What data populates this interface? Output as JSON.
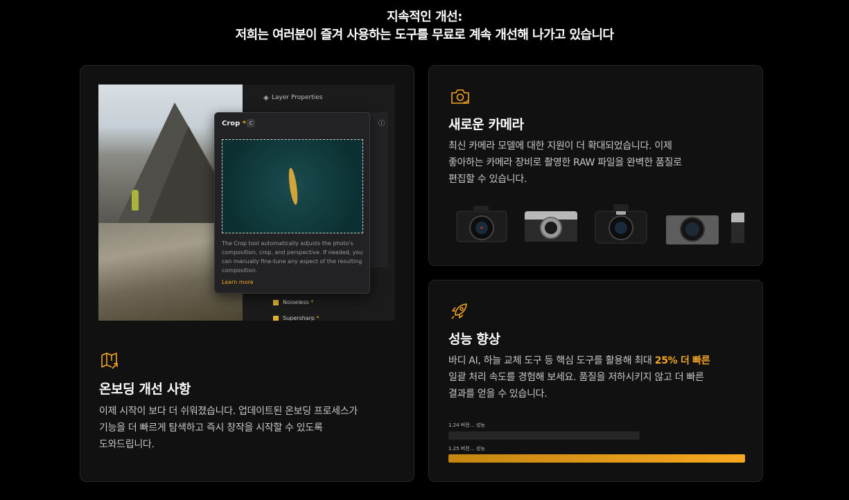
{
  "header": {
    "line1": "지속적인 개선:",
    "line2": "저희는 여러분이 즐겨 사용하는 도구를 무료로 계속 개선해 나가고 있습니다"
  },
  "onboarding": {
    "icon": "map-icon",
    "title": "온보딩 개선 사항",
    "body_line1": "이제 시작이 보다 더 쉬워졌습니다. 업데이트된 온보딩 프로세스가",
    "body_line2": "기능을 더 빠르게 탐색하고 즉시 창작을 시작할 수 있도록",
    "body_line3": "도와드립니다.",
    "mock": {
      "layer_properties": "Layer Properties",
      "tooltip_title": "Crop",
      "tooltip_key": "C",
      "tooltip_desc": "The Crop tool automatically adjusts the photo's composition, crop, and perspective. If needed, you can manually fine-tune any aspect of the resulting composition.",
      "learn_more": "Learn more",
      "row1": "Noiseless",
      "row2": "Supersharp"
    }
  },
  "camera": {
    "icon": "camera-icon",
    "title": "새로운 카메라",
    "body_line1": "최신 카메라 모델에 대한 지원이 더 확대되었습니다. 이제",
    "body_line2": "좋아하는 카메라 장비로 촬영한 RAW 파일을 완벽한 품질로",
    "body_line3": "편집할 수 있습니다."
  },
  "performance": {
    "icon": "rocket-icon",
    "title": "성능 향상",
    "body_line1_a": "바디 AI, 하늘 교체 도구 등 핵심 도구를 활용해 최대 ",
    "body_line1_accent": "25% 더 빠른",
    "body_line2": "일괄 처리 속도를 경험해 보세요. 품질을 저하시키지 않고 더 빠른",
    "body_line3": "결과를 얻을 수 있습니다.",
    "bars": [
      {
        "label": "1.24 버전… 성능",
        "value": 0.75
      },
      {
        "label": "1.25 버전… 성능",
        "value": 1.0
      }
    ],
    "accent_color": "#f5a623"
  }
}
